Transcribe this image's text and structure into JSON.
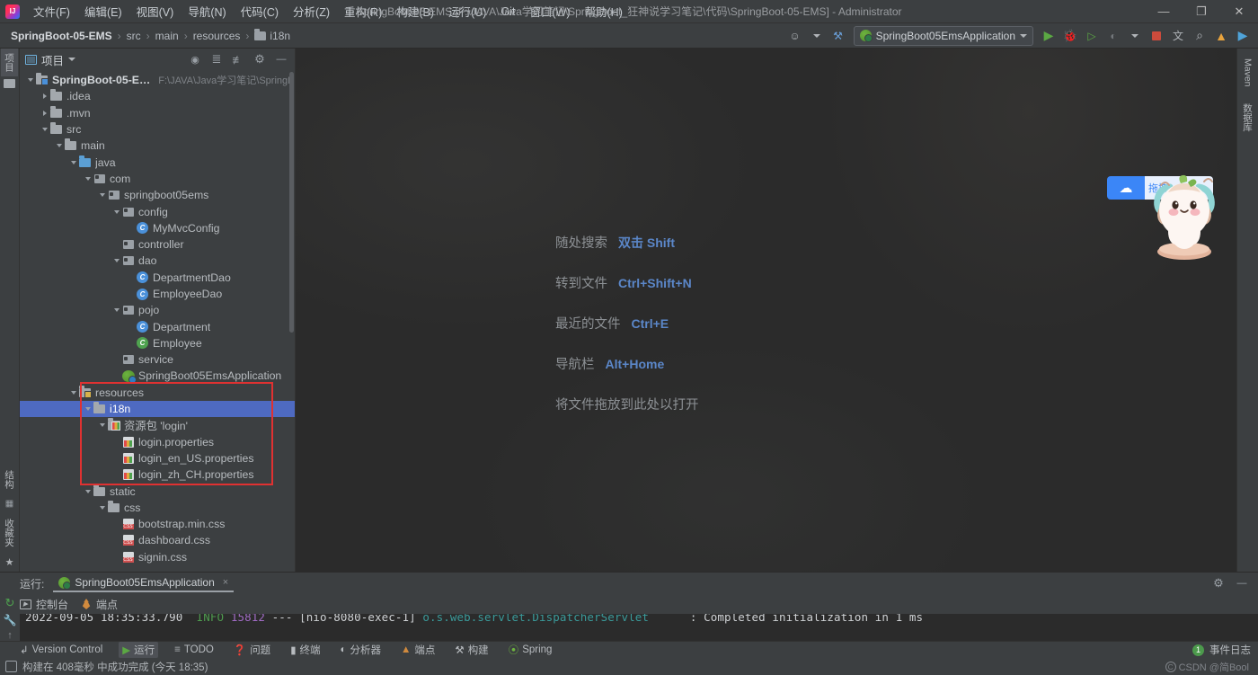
{
  "window": {
    "title": "SpringBoot-05-EMS [F:\\JAVA\\Java学习笔记\\SpringBoot_狂神说学习笔记\\代码\\SpringBoot-05-EMS] - Administrator",
    "controls": {
      "minimize": "—",
      "maximize": "❐",
      "close": "✕"
    }
  },
  "menu": {
    "items": [
      {
        "label": "文件(F)"
      },
      {
        "label": "编辑(E)"
      },
      {
        "label": "视图(V)"
      },
      {
        "label": "导航(N)"
      },
      {
        "label": "代码(C)"
      },
      {
        "label": "分析(Z)"
      },
      {
        "label": "重构(R)"
      },
      {
        "label": "构建(B)"
      },
      {
        "label": "运行(U)"
      },
      {
        "label": "Git"
      },
      {
        "label": "窗口(W)"
      },
      {
        "label": "帮助(H)"
      }
    ]
  },
  "breadcrumb": {
    "items": [
      "SpringBoot-05-EMS",
      "src",
      "main",
      "resources",
      "i18n"
    ],
    "separator": "›"
  },
  "toolbar": {
    "run_config_name": "SpringBoot05EmsApplication",
    "icons": [
      {
        "name": "profile-icon",
        "glyph": "⛉"
      },
      {
        "name": "hammer-icon",
        "glyph": "⚒"
      },
      {
        "name": "run-icon",
        "glyph": "▶"
      },
      {
        "name": "debug-icon",
        "glyph": "🐞"
      },
      {
        "name": "run-with-coverage-icon",
        "glyph": "▷"
      },
      {
        "name": "profiler-icon",
        "glyph": "◔"
      },
      {
        "name": "stop-icon",
        "glyph": "■"
      },
      {
        "name": "translate-icon",
        "glyph": "文A"
      },
      {
        "name": "search-everywhere-icon",
        "glyph": "⌕"
      },
      {
        "name": "update-icon",
        "glyph": "↑"
      },
      {
        "name": "ide-run-icon",
        "glyph": "▶"
      }
    ]
  },
  "left_strip": {
    "items": [
      {
        "label": "项目",
        "active": true,
        "name": "tool-project"
      },
      {
        "label": "",
        "active": false,
        "name": "tool-bookmarks"
      }
    ],
    "bottom_items": [
      {
        "label": "结构",
        "name": "tool-structure"
      },
      {
        "label": "",
        "name": "tool-services"
      },
      {
        "label": "收藏夹",
        "name": "tool-favorites"
      },
      {
        "label": "",
        "name": "tool-star"
      }
    ]
  },
  "right_strip": {
    "items": [
      {
        "label": "Maven",
        "name": "tool-maven"
      },
      {
        "label": "数据库",
        "name": "tool-database"
      }
    ]
  },
  "project_panel": {
    "title": "项目",
    "dropdown_caret": "▾",
    "actions": [
      {
        "name": "locate-icon",
        "glyph": "⊙"
      },
      {
        "name": "expand-all-icon",
        "glyph": "⨌"
      },
      {
        "name": "collapse-all-icon",
        "glyph": "⨋"
      },
      {
        "name": "settings-gear-icon",
        "glyph": "⚙"
      },
      {
        "name": "hide-panel-icon",
        "glyph": "—"
      }
    ],
    "tree": [
      {
        "depth": 0,
        "label": "SpringBoot-05-EMS",
        "icon": "project-folder",
        "arrow": "down",
        "bold": true,
        "hint": "F:\\JAVA\\Java学习笔记\\SpringB"
      },
      {
        "depth": 1,
        "label": ".idea",
        "icon": "folder",
        "arrow": "right"
      },
      {
        "depth": 1,
        "label": ".mvn",
        "icon": "folder",
        "arrow": "right"
      },
      {
        "depth": 1,
        "label": "src",
        "icon": "folder",
        "arrow": "down"
      },
      {
        "depth": 2,
        "label": "main",
        "icon": "folder",
        "arrow": "down"
      },
      {
        "depth": 3,
        "label": "java",
        "icon": "source-folder",
        "arrow": "down"
      },
      {
        "depth": 4,
        "label": "com",
        "icon": "package",
        "arrow": "down"
      },
      {
        "depth": 5,
        "label": "springboot05ems",
        "icon": "package",
        "arrow": "down"
      },
      {
        "depth": 6,
        "label": "config",
        "icon": "package",
        "arrow": "down"
      },
      {
        "depth": 7,
        "label": "MyMvcConfig",
        "icon": "class",
        "arrow": "none"
      },
      {
        "depth": 6,
        "label": "controller",
        "icon": "package",
        "arrow": "none"
      },
      {
        "depth": 6,
        "label": "dao",
        "icon": "package",
        "arrow": "down"
      },
      {
        "depth": 7,
        "label": "DepartmentDao",
        "icon": "class",
        "arrow": "none"
      },
      {
        "depth": 7,
        "label": "EmployeeDao",
        "icon": "class",
        "arrow": "none"
      },
      {
        "depth": 6,
        "label": "pojo",
        "icon": "package",
        "arrow": "down"
      },
      {
        "depth": 7,
        "label": "Department",
        "icon": "class",
        "arrow": "none"
      },
      {
        "depth": 7,
        "label": "Employee",
        "icon": "class-green",
        "arrow": "none"
      },
      {
        "depth": 6,
        "label": "service",
        "icon": "package",
        "arrow": "none"
      },
      {
        "depth": 6,
        "label": "SpringBoot05EmsApplication",
        "icon": "spring-class",
        "arrow": "none"
      },
      {
        "depth": 3,
        "label": "resources",
        "icon": "resource-folder",
        "arrow": "down"
      },
      {
        "depth": 4,
        "label": "i18n",
        "icon": "folder",
        "arrow": "down",
        "selected": true
      },
      {
        "depth": 5,
        "label": "资源包 'login'",
        "icon": "bundle",
        "arrow": "down"
      },
      {
        "depth": 6,
        "label": "login.properties",
        "icon": "properties",
        "arrow": "none"
      },
      {
        "depth": 6,
        "label": "login_en_US.properties",
        "icon": "properties",
        "arrow": "none"
      },
      {
        "depth": 6,
        "label": "login_zh_CH.properties",
        "icon": "properties",
        "arrow": "none"
      },
      {
        "depth": 4,
        "label": "static",
        "icon": "folder",
        "arrow": "down"
      },
      {
        "depth": 5,
        "label": "css",
        "icon": "folder",
        "arrow": "down"
      },
      {
        "depth": 6,
        "label": "bootstrap.min.css",
        "icon": "css",
        "arrow": "none"
      },
      {
        "depth": 6,
        "label": "dashboard.css",
        "icon": "css",
        "arrow": "none"
      },
      {
        "depth": 6,
        "label": "signin.css",
        "icon": "css",
        "arrow": "none"
      }
    ],
    "annotation_color": "#e03131"
  },
  "editor": {
    "shortcuts": [
      {
        "label": "随处搜索",
        "keys": "双击 Shift"
      },
      {
        "label": "转到文件",
        "keys": "Ctrl+Shift+N"
      },
      {
        "label": "最近的文件",
        "keys": "Ctrl+E"
      },
      {
        "label": "导航栏",
        "keys": "Alt+Home"
      }
    ],
    "drop_hint": "将文件拖放到此处以打开"
  },
  "overlay": {
    "netdisk_text": "拖拽",
    "netdisk_icon": "baidu-netdisk-icon"
  },
  "run_panel": {
    "title": "运行:",
    "tab_label": "SpringBoot05EmsApplication",
    "tab_close": "×",
    "subtabs": [
      {
        "label": "控制台",
        "name": "console"
      },
      {
        "label": "端点",
        "name": "endpoints"
      }
    ],
    "actions": [
      {
        "name": "rerun-icon",
        "glyph": "↻"
      },
      {
        "name": "settings-gear-icon",
        "glyph": "⚙"
      },
      {
        "name": "wrench-icon",
        "glyph": "🔧"
      },
      {
        "name": "scroll-up-icon",
        "glyph": "↑"
      },
      {
        "name": "soft-wrap-icon",
        "glyph": "»"
      },
      {
        "name": "hide-panel-icon",
        "glyph": "—"
      }
    ],
    "console_line": {
      "timestamp": "2022-09-05 18:35:33.790",
      "level": "INFO",
      "pid": "15812",
      "dashes": "---",
      "thread": "[nio-8080-exec-1]",
      "logger": "o.s.web.servlet.DispatcherServlet",
      "separator": ":",
      "message": "Completed initialization in 1 ms"
    }
  },
  "toolwindow_bar": {
    "items": [
      {
        "label": "Version Control",
        "icon": "branch-icon",
        "active": false
      },
      {
        "label": "运行",
        "icon": "run-icon",
        "active": true
      },
      {
        "label": "TODO",
        "icon": "list-icon",
        "active": false
      },
      {
        "label": "问题",
        "icon": "warning-icon",
        "active": false
      },
      {
        "label": "终端",
        "icon": "terminal-icon",
        "active": false
      },
      {
        "label": "分析器",
        "icon": "profiler-icon",
        "active": false
      },
      {
        "label": "端点",
        "icon": "endpoints-icon",
        "active": false
      },
      {
        "label": "构建",
        "icon": "hammer-icon",
        "active": false
      },
      {
        "label": "Spring",
        "icon": "spring-leaf-icon",
        "active": false
      }
    ],
    "event_log": {
      "label": "事件日志",
      "count": "1"
    }
  },
  "statusbar": {
    "message": "构建在 408毫秒 中成功完成 (今天 18:35)",
    "watermark": "CSDN @简Bool"
  }
}
